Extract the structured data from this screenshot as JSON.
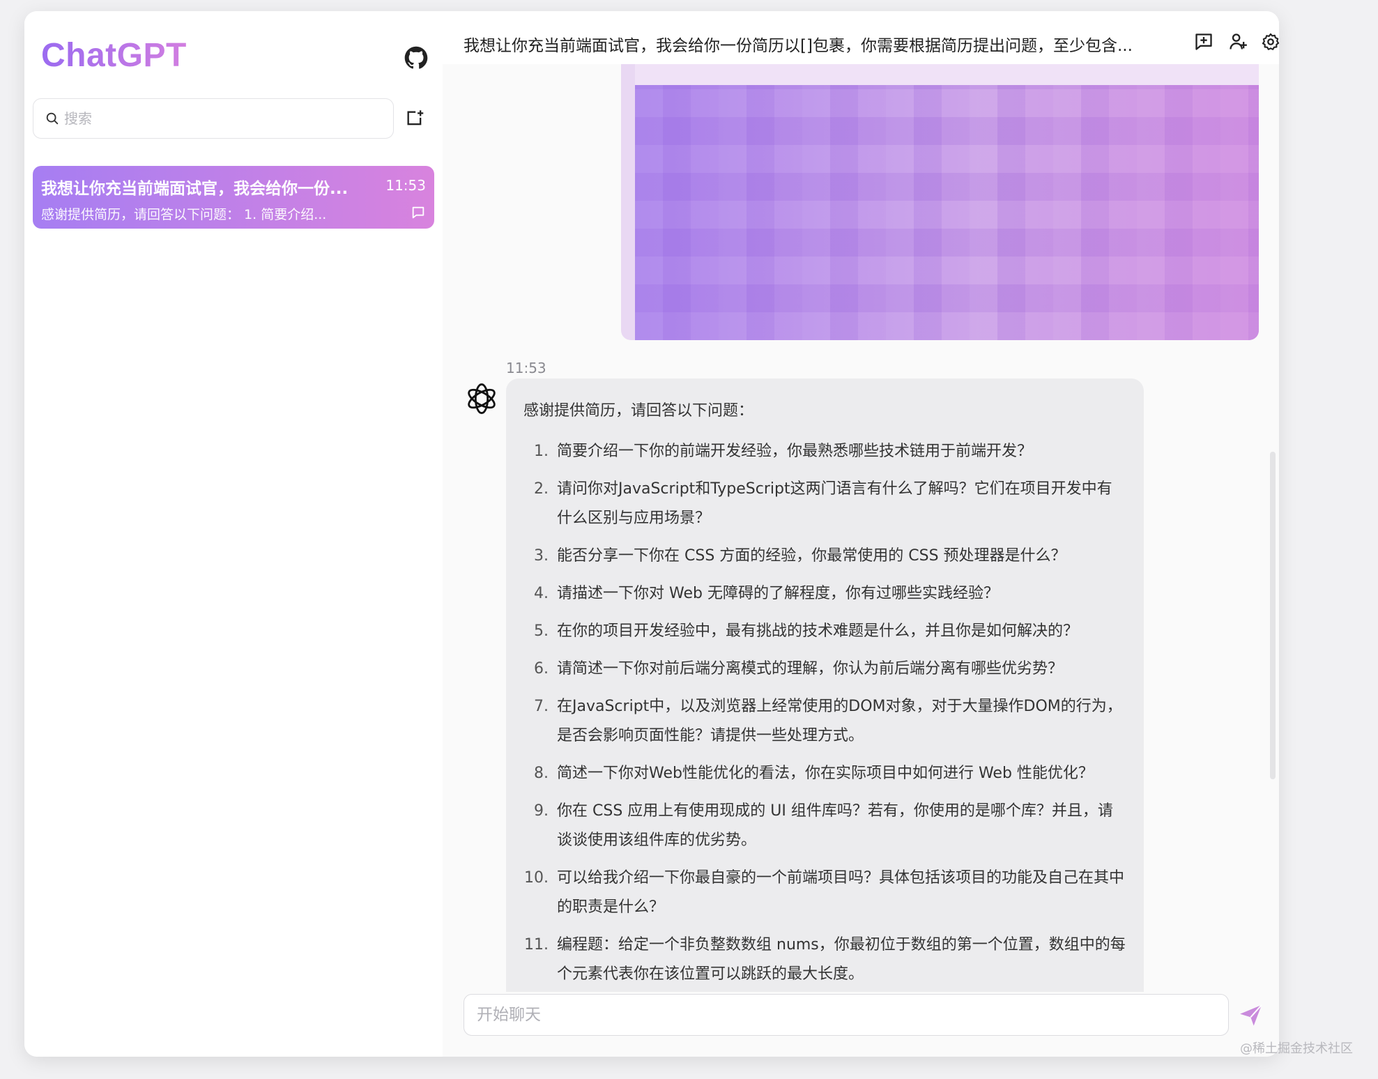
{
  "sidebar": {
    "brand": "ChatGPT",
    "search_placeholder": "搜索",
    "conversation": {
      "title": "我想让你充当前端面试官，我会给你一份...",
      "time": "11:53",
      "preview": "感谢提供简历，请回答以下问题： 1. 简要介绍..."
    }
  },
  "header": {
    "title": "我想让你充当前端面试官，我会给你一份简历以[]包裹，你需要根据简历提出问题，至少包含..."
  },
  "chat": {
    "bot_time": "11:53",
    "intro": "感谢提供简历，请回答以下问题：",
    "questions": [
      {
        "num": "1.",
        "text": "简要介绍一下你的前端开发经验，你最熟悉哪些技术链用于前端开发？"
      },
      {
        "num": "2.",
        "text": "请问你对JavaScript和TypeScript这两门语言有什么了解吗？它们在项目开发中有什么区别与应用场景？"
      },
      {
        "num": "3.",
        "text": "能否分享一下你在 CSS 方面的经验，你最常使用的 CSS 预处理器是什么？"
      },
      {
        "num": "4.",
        "text": "请描述一下你对 Web 无障碍的了解程度，你有过哪些实践经验？"
      },
      {
        "num": "5.",
        "text": "在你的项目开发经验中，最有挑战的技术难题是什么，并且你是如何解决的？"
      },
      {
        "num": "6.",
        "text": "请简述一下你对前后端分离模式的理解，你认为前后端分离有哪些优劣势？"
      },
      {
        "num": "7.",
        "text": "在JavaScript中，以及浏览器上经常使用的DOM对象，对于大量操作DOM的行为，是否会影响页面性能？请提供一些处理方式。"
      },
      {
        "num": "8.",
        "text": "简述一下你对Web性能优化的看法，你在实际项目中如何进行 Web 性能优化？"
      },
      {
        "num": "9.",
        "text": "你在 CSS 应用上有使用现成的 UI 组件库吗？若有，你使用的是哪个库？并且，请谈谈使用该组件库的优劣势。"
      },
      {
        "num": "10.",
        "text": "可以给我介绍一下你最自豪的一个前端项目吗？具体包括该项目的功能及自己在其中的职责是什么？"
      },
      {
        "num": "11.",
        "text": "编程题：给定一个非负整数数组 nums，你最初位于数组的第一个位置，数组中的每个元素代表你在该位置可以跳跃的最大长度。"
      }
    ],
    "input_placeholder": "开始聊天"
  },
  "watermark": "@稀土掘金技术社区",
  "colors": {
    "accent_start": "#a67ef2",
    "accent_end": "#d883de",
    "bubble_bg": "#ececee"
  }
}
